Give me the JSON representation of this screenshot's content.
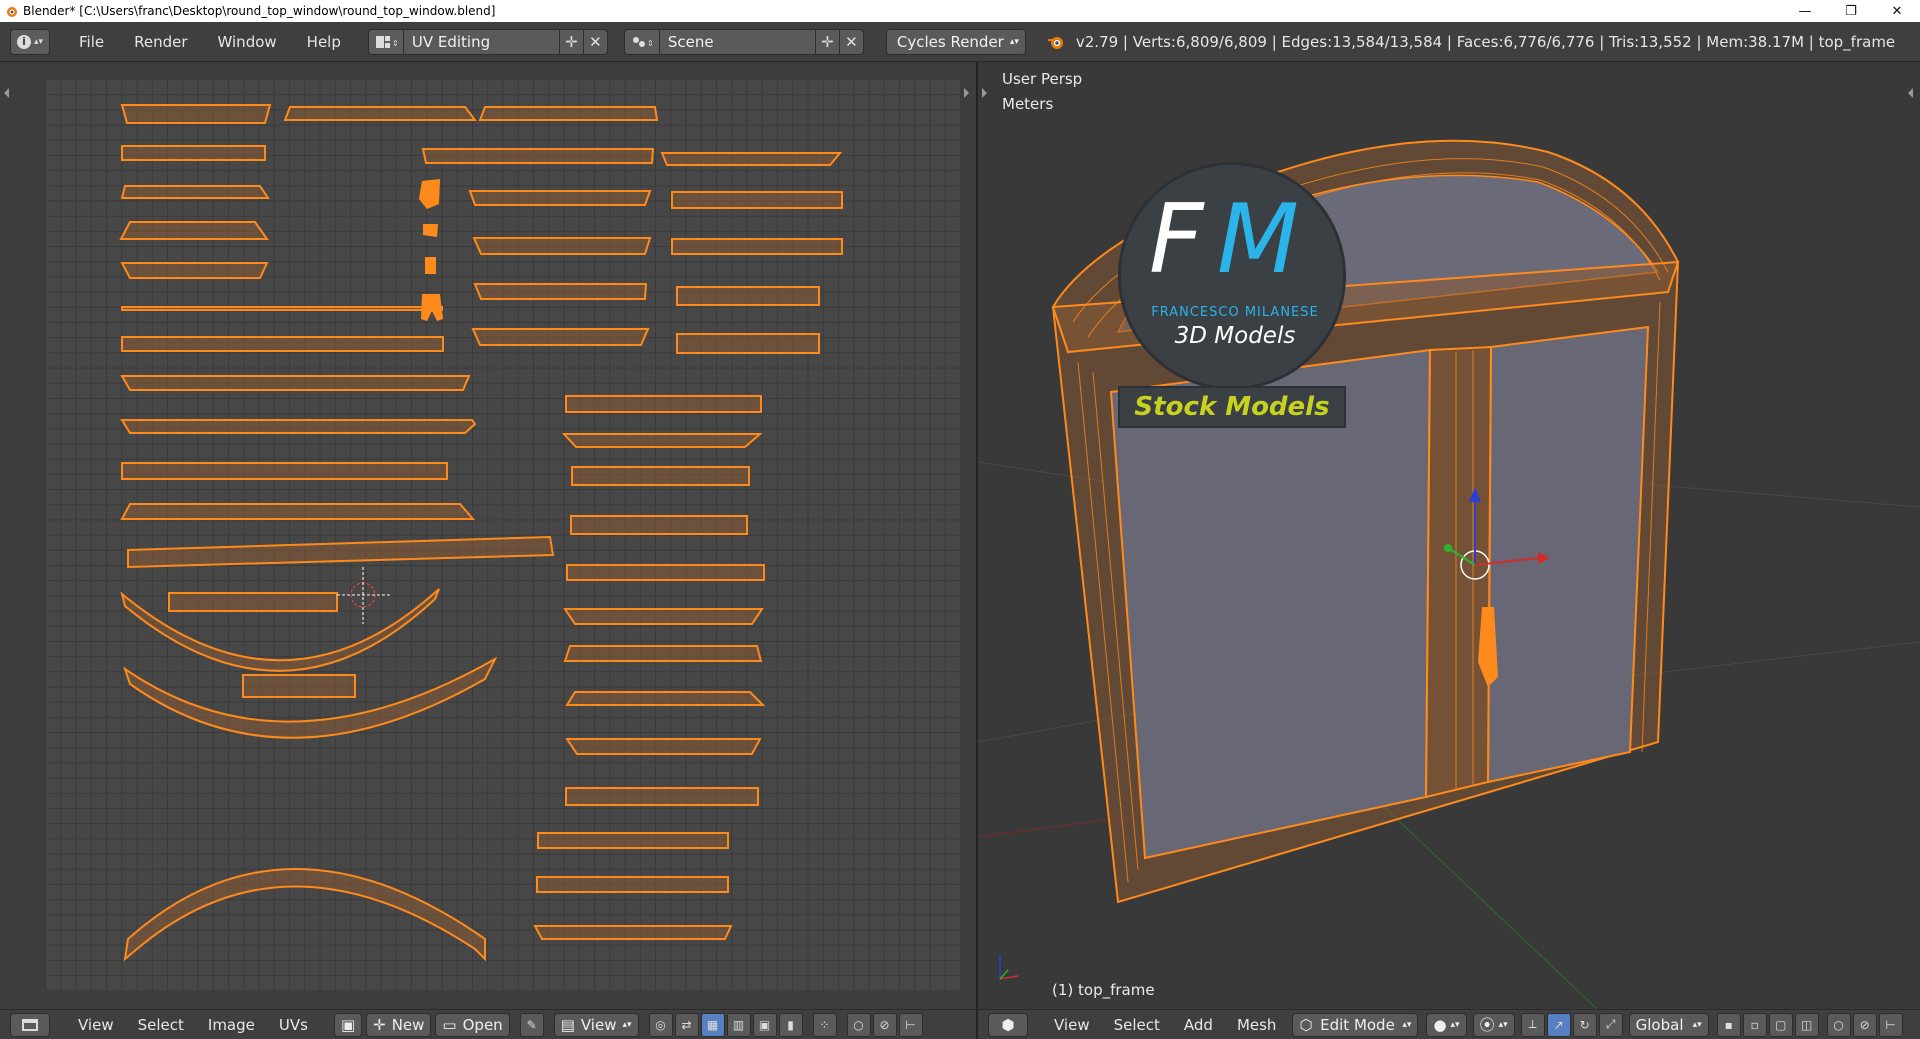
{
  "window": {
    "title": "Blender* [C:\\Users\\franc\\Desktop\\round_top_window\\round_top_window.blend]",
    "minimize": "—",
    "maximize": "❐",
    "close": "✕"
  },
  "info_header": {
    "menu": [
      "File",
      "Render",
      "Window",
      "Help"
    ],
    "screen_layout": "UV Editing",
    "scene": "Scene",
    "render_engine": "Cycles Render",
    "stats": "v2.79 | Verts:6,809/6,809 | Edges:13,584/13,584 | Faces:6,776/6,776 | Tris:13,552 | Mem:38.17M | top_frame"
  },
  "viewport": {
    "view_name": "User Persp",
    "units": "Meters",
    "object_label": "(1) top_frame"
  },
  "watermark": {
    "big_letters_f": "F",
    "big_letters_m": "M",
    "line1": "FRANCESCO MILANESE",
    "line2": "3D Models",
    "banner": "Stock Models"
  },
  "uv_footer": {
    "menu": [
      "View",
      "Select",
      "Image",
      "UVs"
    ],
    "new_label": "New",
    "open_label": "Open",
    "view_label": "View"
  },
  "v3d_footer": {
    "menu": [
      "View",
      "Select",
      "Add",
      "Mesh"
    ],
    "mode": "Edit Mode",
    "orientation": "Global"
  },
  "colors": {
    "accent_orange": "#ff8a1c",
    "uv_fill": "#8a5a33",
    "panel_bg": "#393939",
    "header_bg": "#3f3f3f",
    "banner_text": "#c8d21e",
    "fm_blue": "#2ab4ea"
  }
}
